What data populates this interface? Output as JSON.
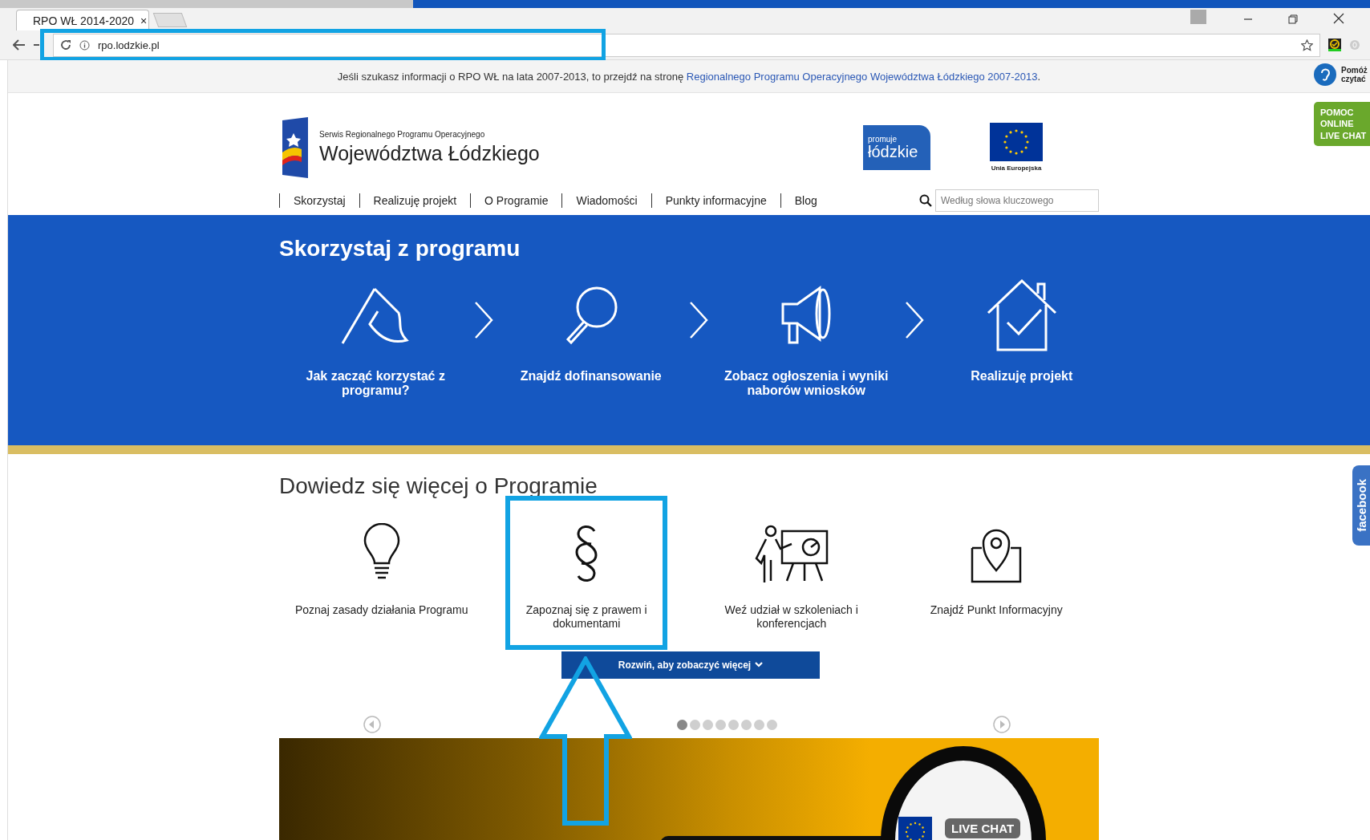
{
  "browser": {
    "tab_title": "RPO WŁ 2014-2020",
    "tab_close": "×",
    "url": "rpo.lodzkie.pl",
    "url_highlighted": true
  },
  "info_bar": {
    "text": "Jeśli szukasz informacji o RPO WŁ na lata 2007-2013, to przejdź na stronę ",
    "link": "Regionalnego Programu Operacyjnego Województwa Łódzkiego 2007-2013",
    "text_after": "."
  },
  "read_aloud": "Pomóż czytać",
  "live_chat_tab": "POMOC ONLINE LIVE CHAT",
  "header": {
    "subtitle": "Serwis Regionalnego Programu Operacyjnego",
    "title": "Województwa Łódzkiego",
    "promo_top": "promuje",
    "promo_bottom": "łódzkie",
    "eu_label": "Unia Europejska"
  },
  "nav": [
    "Skorzystaj",
    "Realizuję projekt",
    "O Programie",
    "Wiadomości",
    "Punkty informacyjne",
    "Blog"
  ],
  "search": {
    "placeholder": "Według słowa kluczowego"
  },
  "hero": {
    "title": "Skorzystaj z programu",
    "steps": [
      {
        "kind": "flag",
        "label": "Jak zacząć korzystać z programu?"
      },
      {
        "kind": "search",
        "label": "Znajdź dofinansowanie"
      },
      {
        "kind": "megaphone",
        "label": "Zobacz ogłoszenia i wyniki naborów wniosków"
      },
      {
        "kind": "house",
        "label": "Realizuję projekt"
      }
    ]
  },
  "more": {
    "title": "Dowiedz się więcej o Programie",
    "items": [
      {
        "kind": "bulb",
        "label": "Poznaj zasady działania Programu",
        "highlighted": false
      },
      {
        "kind": "paragraph",
        "label": "Zapoznaj się z prawem i dokumentami",
        "highlighted": true
      },
      {
        "kind": "teacher",
        "label": "Weź udział w szkoleniach i konferencjach",
        "highlighted": false
      },
      {
        "kind": "pin",
        "label": "Znajdź Punkt Informacyjny",
        "highlighted": false
      }
    ],
    "expand_button": "Rozwiń, aby zobaczyć więcej"
  },
  "carousel": {
    "dots": [
      {
        "selected": true
      },
      {
        "selected": false
      },
      {
        "selected": false
      },
      {
        "selected": false
      },
      {
        "selected": false
      },
      {
        "selected": false
      },
      {
        "selected": false
      },
      {
        "selected": false
      }
    ]
  },
  "banner": {
    "badge": "LIVE CHAT"
  },
  "facebook_tab": "facebook"
}
